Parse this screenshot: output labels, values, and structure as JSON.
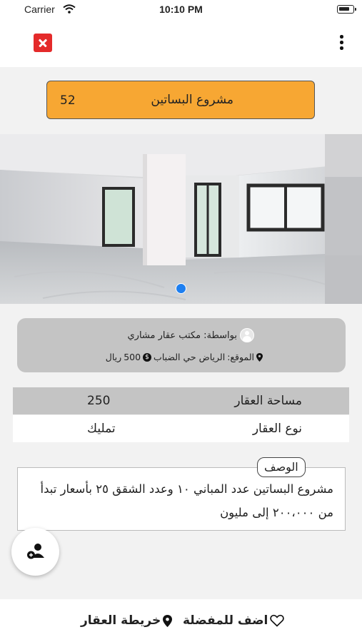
{
  "status_bar": {
    "carrier": "Carrier",
    "time": "10:10 PM"
  },
  "project": {
    "name": "مشروع البساتين",
    "id": "52"
  },
  "agent": {
    "by_label": "بواسطة:",
    "by_value": "مكتب عقار مشاري",
    "location_label": "الموقع:",
    "location_value": "الرياض حي الضباب",
    "price": "500",
    "currency": "ريال"
  },
  "details": [
    {
      "label": "مساحة العقار",
      "value": "250"
    },
    {
      "label": "نوع العقار",
      "value": "تمليك"
    }
  ],
  "description": {
    "label": "الوصف",
    "text": "مشروع البساتين عدد المباني ١٠ وعدد الشقق ٢٥ بأسعار تبدأ من ٢٠٠،٠٠٠ إلى مليون"
  },
  "bottom_bar": {
    "favorite_label": "اضف للمفضلة",
    "map_label": "خريطة العقار"
  },
  "colors": {
    "header": "#f7a733",
    "close": "#e42a2a",
    "dot": "#1e7ff0",
    "card": "#c4c4c4"
  },
  "icons": {
    "close": "close-icon",
    "more": "more-vertical-icon",
    "user": "user-icon",
    "location": "location-pin-icon",
    "coin": "coin-icon",
    "add": "add-contact-icon",
    "heart": "heart-icon"
  }
}
